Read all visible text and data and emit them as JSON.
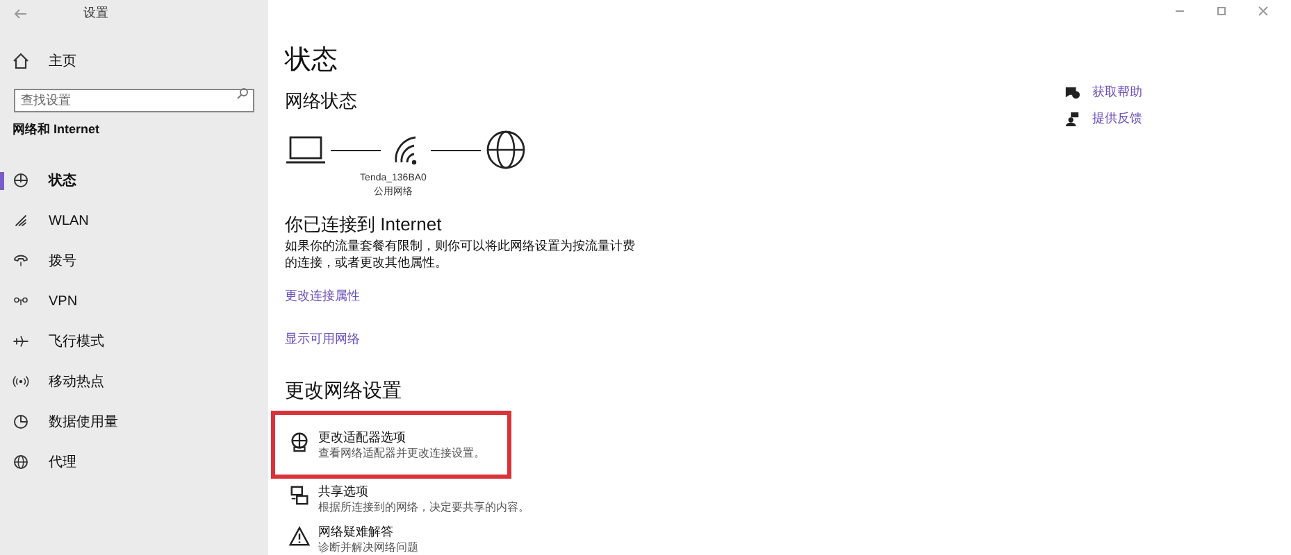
{
  "window": {
    "title": "设置"
  },
  "sidebar": {
    "home": "主页",
    "search": {
      "placeholder": "查找设置"
    },
    "heading": "网络和 Internet",
    "items": [
      {
        "kind": "status",
        "label": "状态",
        "selected": true
      },
      {
        "kind": "wlan",
        "label": "WLAN",
        "selected": false
      },
      {
        "kind": "dialup",
        "label": "拨号",
        "selected": false
      },
      {
        "kind": "vpn",
        "label": "VPN",
        "selected": false
      },
      {
        "kind": "airplane",
        "label": "飞行模式",
        "selected": false
      },
      {
        "kind": "hotspot",
        "label": "移动热点",
        "selected": false
      },
      {
        "kind": "data",
        "label": "数据使用量",
        "selected": false
      },
      {
        "kind": "proxy",
        "label": "代理",
        "selected": false
      }
    ]
  },
  "main": {
    "title": "状态",
    "section": "网络状态",
    "network_name": "Tenda_136BA0",
    "network_type": "公用网络",
    "connected_title": "你已连接到 Internet",
    "connected_text": "如果你的流量套餐有限制，则你可以将此网络设置为按流量计费的连接，或者更改其他属性。",
    "links": [
      "更改连接属性",
      "显示可用网络"
    ],
    "change_heading": "更改网络设置",
    "options": [
      {
        "kind": "adapter",
        "title": "更改适配器选项",
        "description": "查看网络适配器并更改连接设置。",
        "highlighted": true
      },
      {
        "kind": "sharing",
        "title": "共享选项",
        "description": "根据所连接到的网络，决定要共享的内容。",
        "highlighted": false
      },
      {
        "kind": "troubleshoot",
        "title": "网络疑难解答",
        "description": "诊断并解决网络问题",
        "highlighted": false
      }
    ]
  },
  "help": [
    {
      "kind": "help",
      "label": "获取帮助"
    },
    {
      "kind": "feedback",
      "label": "提供反馈"
    }
  ]
}
